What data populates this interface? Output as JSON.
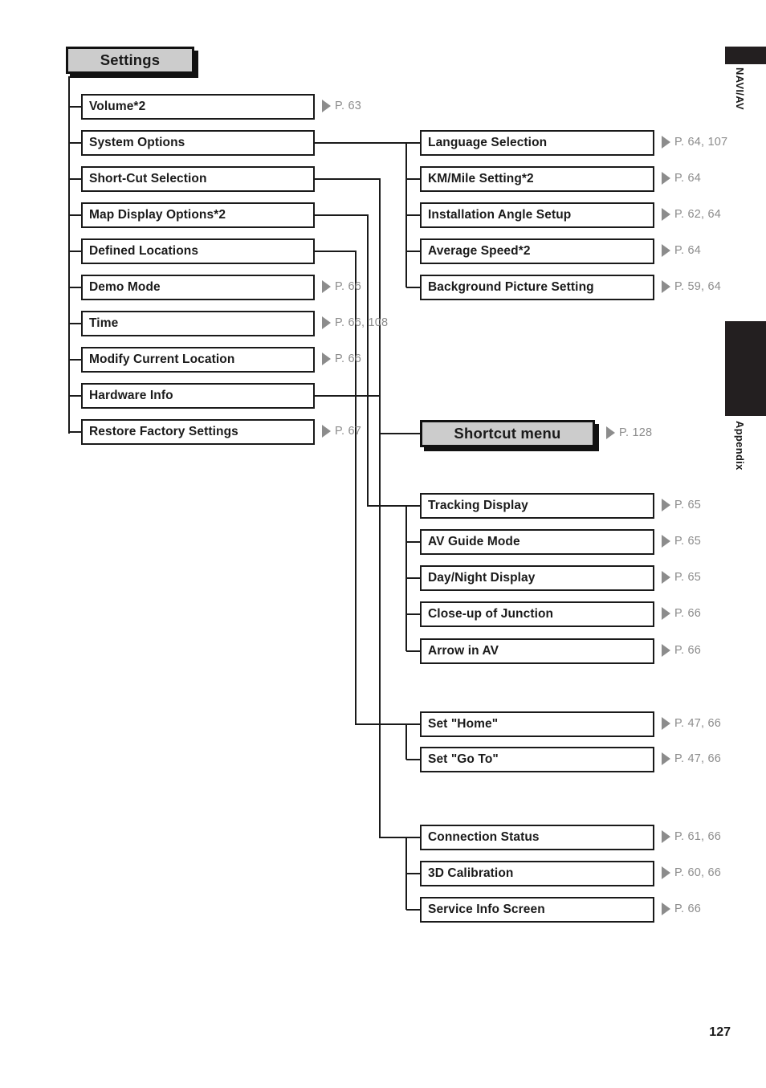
{
  "page": {
    "folio": "127",
    "side_tabs": [
      {
        "label": "NAVI/AV"
      },
      {
        "label": "Appendix"
      }
    ]
  },
  "diagram": {
    "type": "menu-tree",
    "root": {
      "label": "Settings",
      "style": "header"
    },
    "shortcut_header": {
      "label": "Shortcut menu",
      "style": "header",
      "page_ref": "P. 128"
    },
    "left_column": [
      {
        "label": "Volume*2",
        "page_ref": "P. 63",
        "has_branch": false
      },
      {
        "label": "System Options",
        "page_ref": "",
        "has_branch": true
      },
      {
        "label": "Short-Cut Selection",
        "page_ref": "",
        "has_branch": true
      },
      {
        "label": "Map Display Options*2",
        "page_ref": "",
        "has_branch": true
      },
      {
        "label": "Defined Locations",
        "page_ref": "",
        "has_branch": true
      },
      {
        "label": "Demo Mode",
        "page_ref": "P. 66",
        "has_branch": false
      },
      {
        "label": "Time",
        "page_ref": "P. 66, 108",
        "has_branch": false
      },
      {
        "label": "Modify Current Location",
        "page_ref": "P. 66",
        "has_branch": false
      },
      {
        "label": "Hardware Info",
        "page_ref": "",
        "has_branch": true
      },
      {
        "label": "Restore Factory Settings",
        "page_ref": "P. 67",
        "has_branch": false
      }
    ],
    "groups": [
      {
        "name": "system-options-submenu",
        "parent": "System Options",
        "items": [
          {
            "label": "Language Selection",
            "page_ref": "P. 64, 107"
          },
          {
            "label": "KM/Mile Setting*2",
            "page_ref": "P. 64"
          },
          {
            "label": "Installation Angle Setup",
            "page_ref": "P. 62, 64"
          },
          {
            "label": "Average Speed*2",
            "page_ref": "P. 64"
          },
          {
            "label": "Background Picture Setting",
            "page_ref": "P. 59, 64"
          }
        ]
      },
      {
        "name": "map-display-options-submenu",
        "parent": "Map Display Options*2",
        "items": [
          {
            "label": "Tracking Display",
            "page_ref": "P. 65"
          },
          {
            "label": "AV Guide Mode",
            "page_ref": "P. 65"
          },
          {
            "label": "Day/Night Display",
            "page_ref": "P. 65"
          },
          {
            "label": "Close-up of Junction",
            "page_ref": "P. 66"
          },
          {
            "label": "Arrow in AV",
            "page_ref": "P. 66"
          }
        ]
      },
      {
        "name": "defined-locations-submenu",
        "parent": "Defined Locations",
        "items": [
          {
            "label": "Set \"Home\"",
            "page_ref": "P. 47, 66"
          },
          {
            "label": "Set \"Go To\"",
            "page_ref": "P. 47, 66"
          }
        ]
      },
      {
        "name": "hardware-info-submenu",
        "parent": "Hardware Info",
        "items": [
          {
            "label": "Connection Status",
            "page_ref": "P. 61, 66"
          },
          {
            "label": "3D Calibration",
            "page_ref": "P. 60, 66"
          },
          {
            "label": "Service Info Screen",
            "page_ref": "P. 66"
          }
        ]
      }
    ],
    "colors": {
      "line": "#1a1a1a",
      "header_fill": "#cccccc",
      "page_ref": "#8c8c8c",
      "tab_fill": "#231f20"
    }
  }
}
